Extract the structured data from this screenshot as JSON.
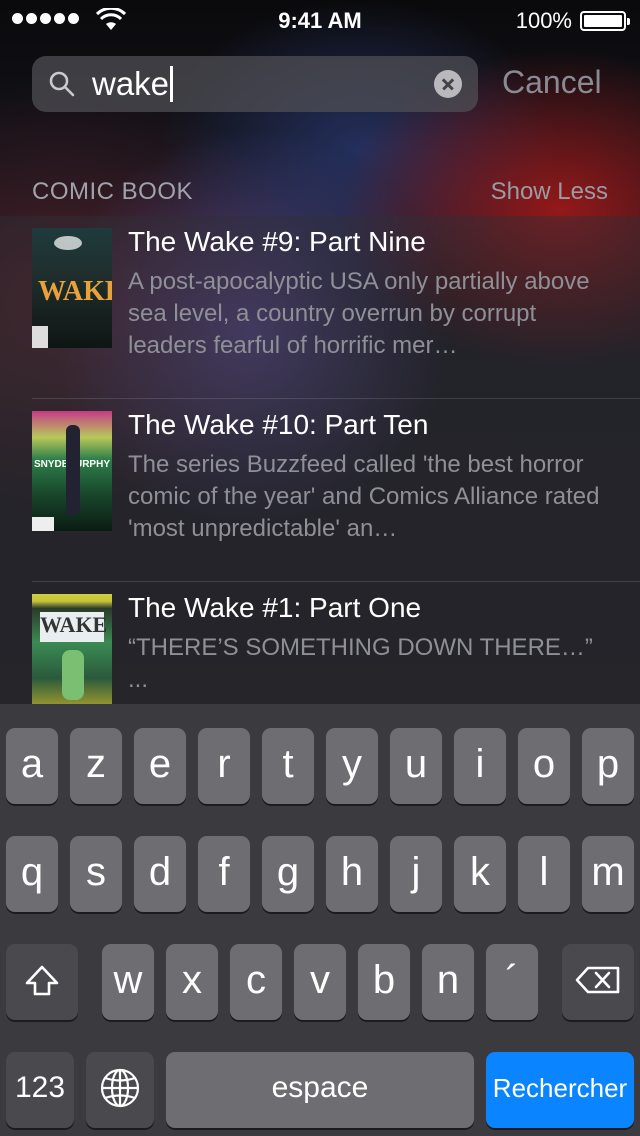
{
  "status_bar": {
    "time": "9:41 AM",
    "battery": "100%",
    "signal_bars": 5,
    "wifi": "wifi-icon"
  },
  "search": {
    "query": "wake",
    "cancel_label": "Cancel",
    "icon": "search-icon",
    "clear_icon": "clear-icon"
  },
  "section": {
    "title": "COMIC BOOK",
    "action": "Show Less"
  },
  "results": [
    {
      "title": "The Wake #9: Part Nine",
      "description": "A post-apocalyptic USA only partially above sea level, a country overrun by corrupt leaders fearful of horrific mer…"
    },
    {
      "title": "The Wake #10: Part Ten",
      "description": "The series Buzzfeed called 'the best horror comic of the year' and Comics Alliance rated 'most unpredictable' an…"
    },
    {
      "title": "The Wake #1: Part One",
      "description": "“THERE’S SOMETHING DOWN THERE…” ..."
    }
  ],
  "keyboard": {
    "row1": [
      "a",
      "z",
      "e",
      "r",
      "t",
      "y",
      "u",
      "i",
      "o",
      "p"
    ],
    "row2": [
      "q",
      "s",
      "d",
      "f",
      "g",
      "h",
      "j",
      "k",
      "l",
      "m"
    ],
    "row3": [
      "w",
      "x",
      "c",
      "v",
      "b",
      "n",
      "´"
    ],
    "numbers_key": "123",
    "space_key": "espace",
    "return_key": "Rechercher",
    "shift_icon": "shift-icon",
    "backspace_icon": "backspace-icon",
    "globe_icon": "globe-icon",
    "return_color": "#0a84ff"
  }
}
